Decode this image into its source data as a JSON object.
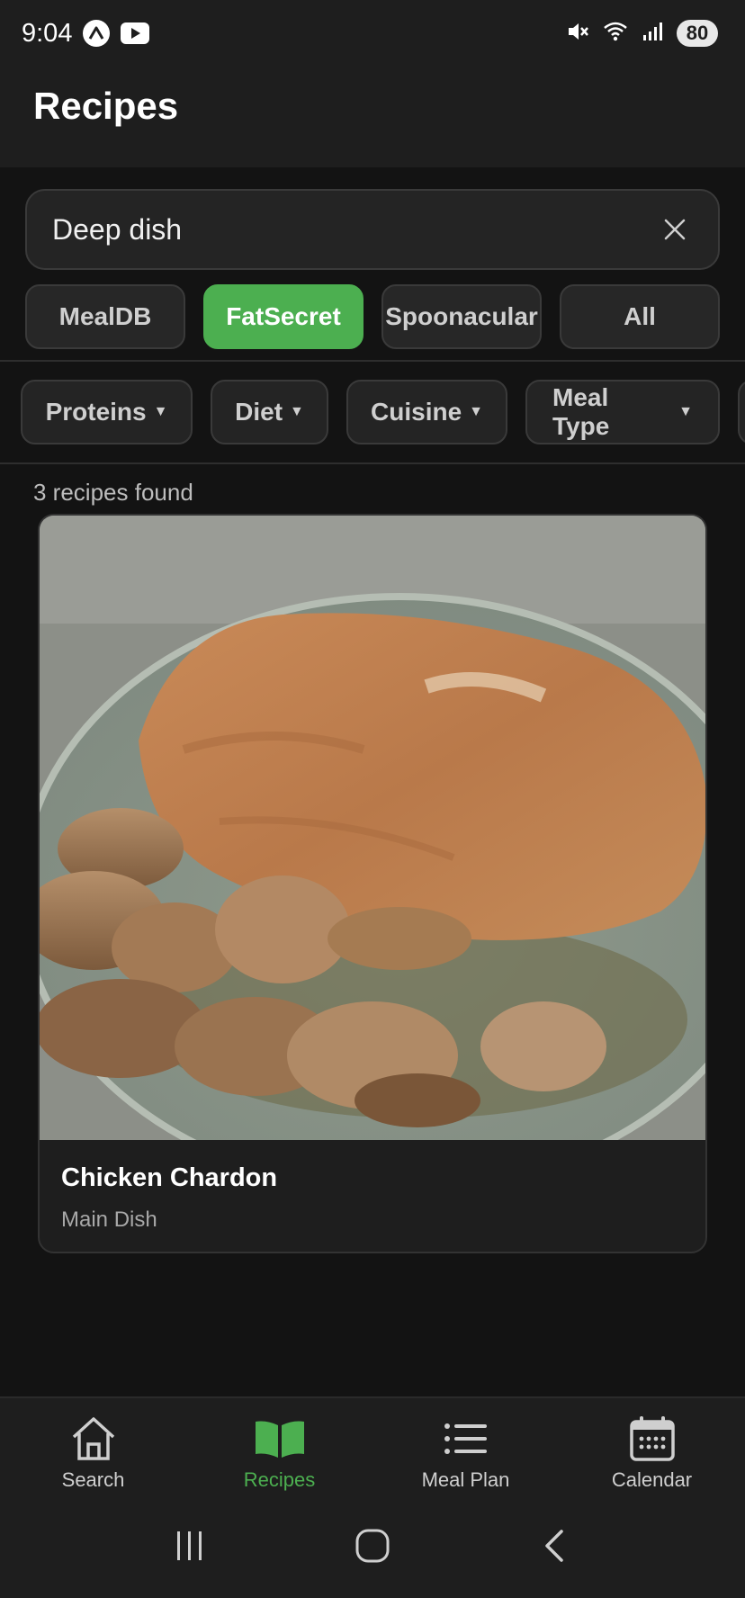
{
  "status_bar": {
    "time": "9:04",
    "battery": "80",
    "icons": [
      "notification-a-icon",
      "youtube-icon",
      "mute-icon",
      "wifi-icon",
      "signal-icon"
    ]
  },
  "header": {
    "title": "Recipes"
  },
  "search": {
    "value": "Deep dish"
  },
  "sources": [
    {
      "label": "MealDB",
      "active": false
    },
    {
      "label": "FatSecret",
      "active": true
    },
    {
      "label": "Spoonacular",
      "active": false
    },
    {
      "label": "All",
      "active": false
    }
  ],
  "filters": [
    {
      "label": "Proteins"
    },
    {
      "label": "Diet"
    },
    {
      "label": "Cuisine"
    },
    {
      "label": "Meal Type"
    }
  ],
  "results": {
    "count_text": "3 recipes found"
  },
  "recipe": {
    "title": "Chicken Chardon",
    "category": "Main Dish",
    "image_icon": "breaded-chicken-with-mushrooms-photo"
  },
  "bottom_nav": [
    {
      "label": "Search",
      "icon": "house-icon",
      "active": false
    },
    {
      "label": "Recipes",
      "icon": "open-book-icon",
      "active": true
    },
    {
      "label": "Meal Plan",
      "icon": "list-icon",
      "active": false
    },
    {
      "label": "Calendar",
      "icon": "calendar-icon",
      "active": false
    }
  ],
  "colors": {
    "accent": "#4caf50",
    "background": "#131313",
    "surface": "#1e1e1e"
  }
}
